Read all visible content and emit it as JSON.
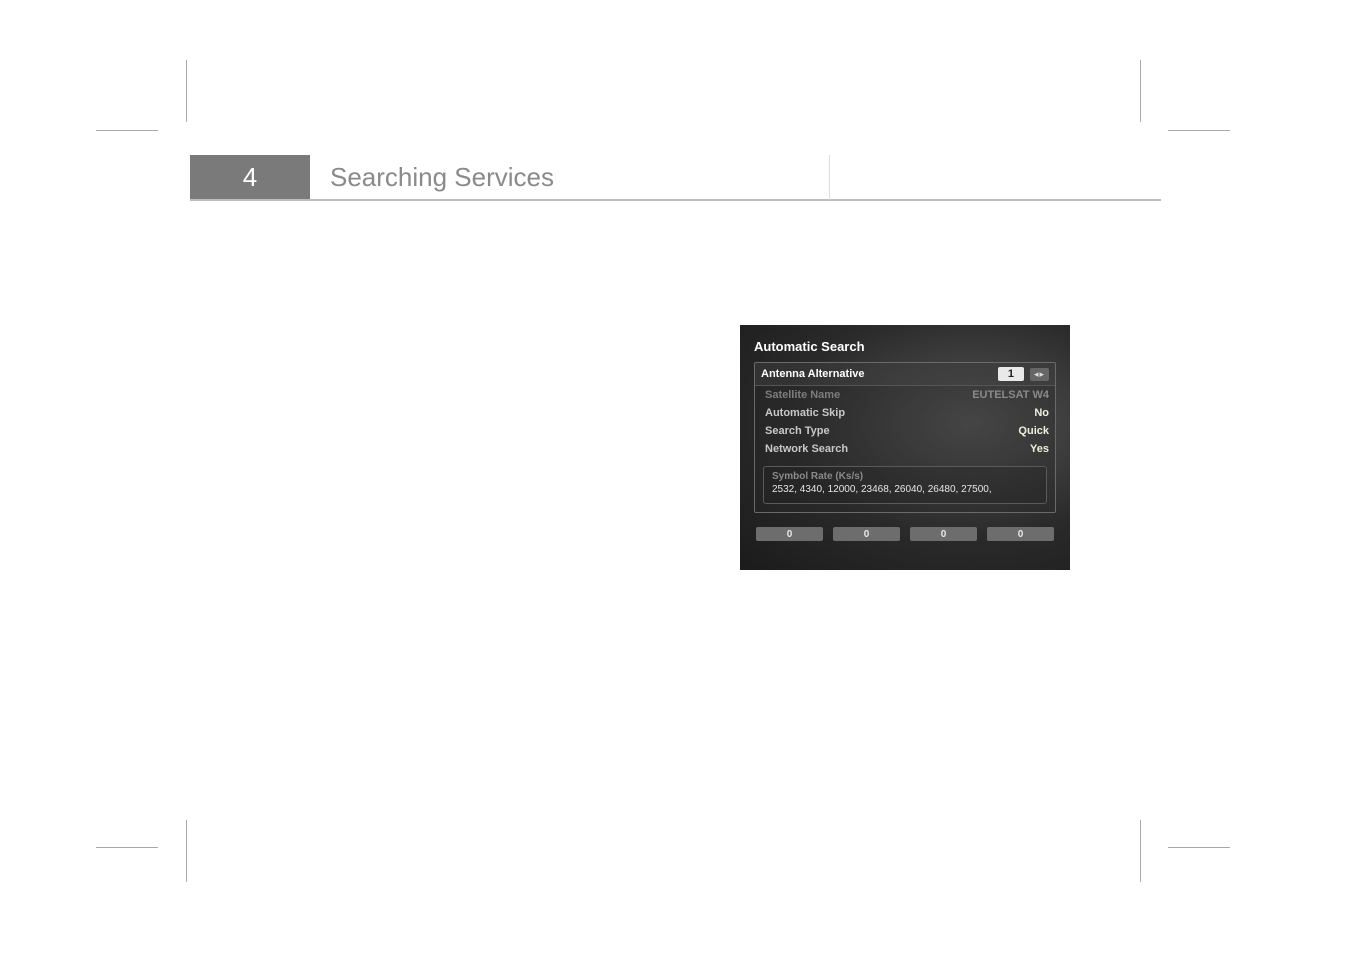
{
  "page": {
    "chapter_number": "4",
    "chapter_title": "Searching Services"
  },
  "screenshot": {
    "window_title": "Automatic Search",
    "selected_row": {
      "label": "Antenna Alternative",
      "value": "1"
    },
    "rows": [
      {
        "label": "Satellite Name",
        "value": "EUTELSAT W4",
        "dim": true
      },
      {
        "label": "Automatic Skip",
        "value": "No",
        "dim": false
      },
      {
        "label": "Search Type",
        "value": "Quick",
        "dim": false
      },
      {
        "label": "Network Search",
        "value": "Yes",
        "dim": false
      }
    ],
    "subpanel": {
      "title": "Symbol Rate (Ks/s)",
      "value": "2532, 4340, 12000, 23468, 26040, 26480, 27500,"
    },
    "status": [
      "0",
      "0",
      "0",
      "0"
    ]
  }
}
